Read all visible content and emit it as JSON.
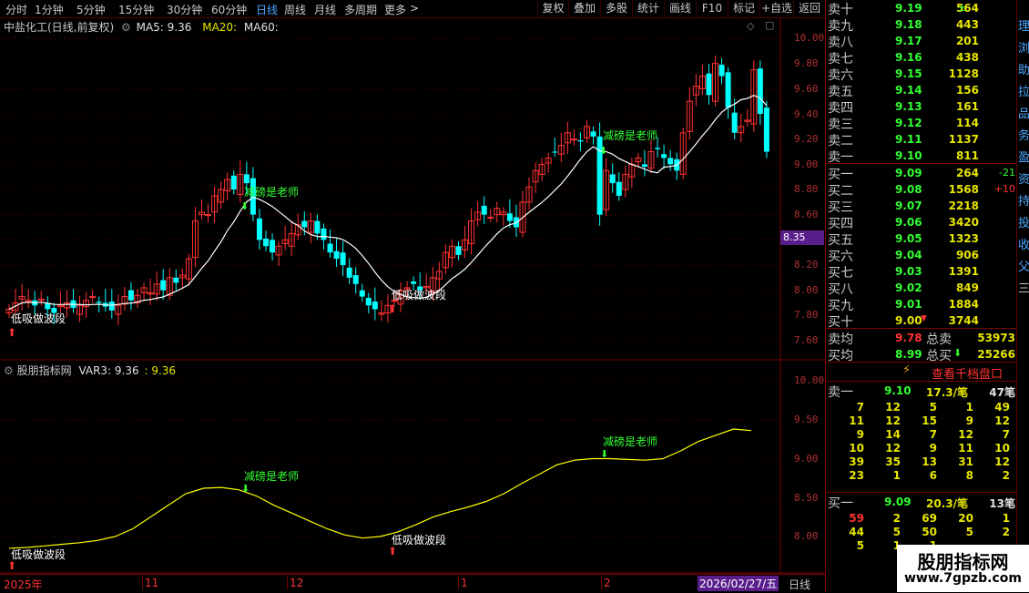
{
  "toolbar": {
    "periods": [
      "分时",
      "1分钟",
      "5分钟",
      "15分钟",
      "30分钟",
      "60分钟",
      "日线",
      "周线",
      "月线",
      "多周期",
      "更多"
    ],
    "active_period": "日线",
    "more_arrow": ">",
    "buttons": [
      "复权",
      "叠加",
      "多股",
      "统计",
      "画线",
      "F10",
      "标记",
      "+自选",
      "返回"
    ]
  },
  "main_chart": {
    "stock_title": "中盐化工(日线,前复权)",
    "ma5_label": "MA5: 9.36",
    "ma20_label": "MA20:",
    "ma60_label": "MA60:",
    "y_ticks": [
      "10.00",
      "9.80",
      "9.60",
      "9.40",
      "9.20",
      "9.00",
      "8.80",
      "8.60",
      "8.40",
      "8.20",
      "8.00",
      "7.80",
      "7.60"
    ],
    "current_price_tag": "8.35",
    "annotation_sell": "减磅是老师",
    "annotation_buy": "低吸做波段",
    "colors": {
      "up": "#ff3232",
      "down": "#00ffff",
      "ma": "#ffffff",
      "tag_bg": "#5a1e8c"
    }
  },
  "indicator": {
    "name": "股朋指标网",
    "var_label": "VAR3: 9.36",
    "var_value": ": 9.36",
    "y_ticks": [
      "10.00",
      "9.50",
      "9.00",
      "8.50",
      "8.00"
    ],
    "line_color": "#ffff00",
    "annotation_sell": "减磅是老师",
    "annotation_buy": "低吸做波段"
  },
  "time_axis": {
    "labels": [
      "2025年",
      "11",
      "12",
      "1",
      "2"
    ],
    "date_box": "2026/02/27/五",
    "period_label": "日线"
  },
  "order_book": {
    "asks": [
      {
        "label": "卖十",
        "price": "9.19",
        "vol": "564",
        "mark": "±"
      },
      {
        "label": "卖九",
        "price": "9.18",
        "vol": "443"
      },
      {
        "label": "卖八",
        "price": "9.17",
        "vol": "201"
      },
      {
        "label": "卖七",
        "price": "9.16",
        "vol": "438"
      },
      {
        "label": "卖六",
        "price": "9.15",
        "vol": "1128"
      },
      {
        "label": "卖五",
        "price": "9.14",
        "vol": "156"
      },
      {
        "label": "卖四",
        "price": "9.13",
        "vol": "161"
      },
      {
        "label": "卖三",
        "price": "9.12",
        "vol": "114"
      },
      {
        "label": "卖二",
        "price": "9.11",
        "vol": "1137"
      },
      {
        "label": "卖一",
        "price": "9.10",
        "vol": "811"
      }
    ],
    "bids": [
      {
        "label": "买一",
        "price": "9.09",
        "vol": "264",
        "chg": "-21"
      },
      {
        "label": "买二",
        "price": "9.08",
        "vol": "1568",
        "chg": "+10"
      },
      {
        "label": "买三",
        "price": "9.07",
        "vol": "2218"
      },
      {
        "label": "买四",
        "price": "9.06",
        "vol": "3420"
      },
      {
        "label": "买五",
        "price": "9.05",
        "vol": "1323"
      },
      {
        "label": "买六",
        "price": "9.04",
        "vol": "906"
      },
      {
        "label": "买七",
        "price": "9.03",
        "vol": "1391"
      },
      {
        "label": "买八",
        "price": "9.02",
        "vol": "849"
      },
      {
        "label": "买九",
        "price": "9.01",
        "vol": "1884"
      },
      {
        "label": "买十",
        "price": "9.00",
        "vol": "3744",
        "mark": "▼"
      }
    ],
    "avg_sell_label": "卖均",
    "avg_sell_price": "9.78",
    "total_sell_label": "总卖",
    "total_sell": "53973",
    "avg_buy_label": "买均",
    "avg_buy_price": "8.99",
    "total_buy_label": "总买",
    "total_buy": "25266",
    "thousand_button": "查看千档盘口",
    "queue_sell": {
      "label": "卖一",
      "price": "9.10",
      "avg": "17.3/笔",
      "count": "47笔",
      "rows": [
        [
          "7",
          "12",
          "5",
          "1",
          "49"
        ],
        [
          "11",
          "12",
          "15",
          "9",
          "12"
        ],
        [
          "9",
          "14",
          "7",
          "12",
          "7"
        ],
        [
          "10",
          "12",
          "9",
          "11",
          "10"
        ],
        [
          "39",
          "35",
          "13",
          "31",
          "12"
        ],
        [
          "23",
          "1",
          "6",
          "8",
          "2"
        ]
      ]
    },
    "queue_buy": {
      "label": "买一",
      "price": "9.09",
      "avg": "20.3/笔",
      "count": "13笔",
      "rows": [
        [
          "59",
          "2",
          "69",
          "20",
          "1"
        ],
        [
          "44",
          "5",
          "50",
          "5",
          "2"
        ],
        [
          "5",
          "1",
          "1",
          "",
          ""
        ]
      ]
    }
  },
  "edge_chars": [
    "理",
    "浏",
    "助",
    "拉",
    "品",
    "务",
    "盈",
    "资",
    "持",
    "投",
    "收",
    "父",
    "三"
  ],
  "watermark": {
    "title": "股朋指标网",
    "url": "www.7gpzb.com"
  }
}
